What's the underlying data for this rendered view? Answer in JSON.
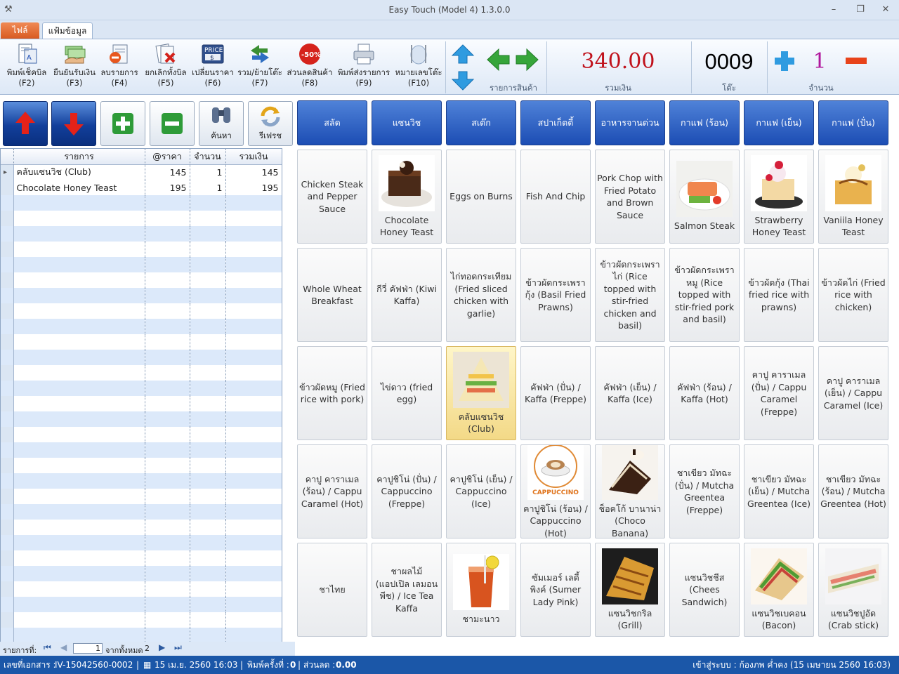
{
  "window": {
    "title": "Easy Touch (Model 4) 1.3.0.0"
  },
  "tabs": {
    "file": "ไฟล์",
    "data": "แฟ้มข้อมูล"
  },
  "ribbon": {
    "buttons": [
      {
        "label": "พิมพ์เช็คบิล",
        "key": "(F2)",
        "icon": "bill-icon"
      },
      {
        "label": "ยืนยันรับเงิน",
        "key": "(F3)",
        "icon": "cash-icon"
      },
      {
        "label": "ลบรายการ",
        "key": "(F4)",
        "icon": "delete-item-icon"
      },
      {
        "label": "ยกเลิกทั้งบิล",
        "key": "(F5)",
        "icon": "cancel-bill-icon"
      },
      {
        "label": "เปลี่ยนราคา",
        "key": "(F6)",
        "icon": "price-tag-icon"
      },
      {
        "label": "รวม/ย้ายโต๊ะ",
        "key": "(F7)",
        "icon": "move-table-icon"
      },
      {
        "label": "ส่วนลดสินค้า",
        "key": "(F8)",
        "icon": "discount-icon"
      },
      {
        "label": "พิมพ์ส่งรายการ",
        "key": "(F9)",
        "icon": "printer-icon"
      },
      {
        "label": "หมายเลขโต๊ะ",
        "key": "(F10)",
        "icon": "table-number-icon"
      }
    ],
    "price_badge": "PRICE",
    "discount_badge": "-50%",
    "group_items_label": "รายการสินค้า",
    "total_value": "340.00",
    "total_label": "รวมเงิน",
    "table_value": "0009",
    "table_label": "โต๊ะ",
    "qty_value": "1",
    "qty_label": "จำนวน"
  },
  "toolbar": {
    "search_label": "ค้นหา",
    "refresh_label": "รีเฟรช"
  },
  "grid": {
    "headers": [
      "รายการ",
      "@ราคา",
      "จำนวน",
      "รวมเงิน"
    ],
    "rows": [
      {
        "item": "คลับแซนวิช (Club)",
        "price": "145",
        "qty": "1",
        "total": "145"
      },
      {
        "item": "Chocolate Honey Teast",
        "price": "195",
        "qty": "1",
        "total": "195"
      }
    ]
  },
  "nav": {
    "label": "รายการที่:",
    "page": "1",
    "of_label": "จากทั้งหมด",
    "total": "2"
  },
  "categories": [
    "สลัด",
    "แซนวิช",
    "สเต๊ก",
    "สปาเก็ตตี้",
    "อาหารจานด่วน",
    "กาแฟ (ร้อน)",
    "กาแฟ (เย็น)",
    "กาแฟ (ปั่น)"
  ],
  "products": [
    {
      "name": "Chicken Steak and Pepper Sauce"
    },
    {
      "name": "Chocolate Honey Teast",
      "img": "chocolate-toast"
    },
    {
      "name": "Eggs on Burns"
    },
    {
      "name": "Fish And Chip"
    },
    {
      "name": "Pork Chop with Fried Potato and Brown Sauce"
    },
    {
      "name": "Salmon Steak",
      "img": "salmon"
    },
    {
      "name": "Strawberry Honey Teast",
      "img": "strawberry-toast"
    },
    {
      "name": "Vaniila Honey Teast",
      "img": "vanilla-toast"
    },
    {
      "name": "Whole Wheat Breakfast"
    },
    {
      "name": "กีวี่ คัฟฟ่า (Kiwi Kaffa)"
    },
    {
      "name": "ไก่ทอดกระเทียม (Fried sliced chicken with garlie)"
    },
    {
      "name": "ข้าวผัดกระเพรากุ้ง (Basil Fried Prawns)"
    },
    {
      "name": "ข้าวผัดกระเพราไก่ (Rice topped with stir-fried chicken and basil)"
    },
    {
      "name": "ข้าวผัดกระเพราหมู (Rice topped with stir-fried pork and basil)"
    },
    {
      "name": "ข้าวผัดกุ้ง (Thai fried rice with prawns)"
    },
    {
      "name": "ข้าวผัดไก่ (Fried rice with chicken)"
    },
    {
      "name": "ข้าวผัดหมู (Fried rice with pork)"
    },
    {
      "name": "ไข่ดาว (fried egg)"
    },
    {
      "name": "คลับแซนวิช (Club)",
      "img": "club-sandwich",
      "selected": true
    },
    {
      "name": "คัฟฟ่า (ปั่น) / Kaffa (Freppe)"
    },
    {
      "name": "คัฟฟ่า (เย็น) / Kaffa (Ice)"
    },
    {
      "name": "คัฟฟ่า (ร้อน) / Kaffa (Hot)"
    },
    {
      "name": "คาปู คาราเมล (ปั่น) / Cappu Caramel (Freppe)"
    },
    {
      "name": "คาปู คาราเมล (เย็น) / Cappu Caramel (Ice)"
    },
    {
      "name": "คาปู คาราเมล (ร้อน) / Cappu Caramel (Hot)"
    },
    {
      "name": "คาปูชิโน่ (ปั่น) / Cappuccino (Freppe)"
    },
    {
      "name": "คาปูชิโน่ (เย็น) / Cappuccino (Ice)"
    },
    {
      "name": "คาปูชิโน่ (ร้อน) / Cappuccino (Hot)",
      "img": "cappuccino",
      "img_text": "CAPPUCCINO"
    },
    {
      "name": "ช็อคโก้ บานาน่า (Choco Banana)",
      "img": "choco-banana"
    },
    {
      "name": "ชาเขียว มัทฉะ (ปั่น) / Mutcha Greentea (Freppe)"
    },
    {
      "name": "ชาเขียว มัทฉะ (เย็น) / Mutcha Greentea (Ice)"
    },
    {
      "name": "ชาเขียว มัทฉะ (ร้อน) / Mutcha Greentea (Hot)"
    },
    {
      "name": "ชาไทย"
    },
    {
      "name": "ชาผลไม้ (แอปเปิล เลมอน พีช) / Ice Tea Kaffa"
    },
    {
      "name": "ชามะนาว",
      "img": "lemon-tea"
    },
    {
      "name": "ซัมเมอร์ เลดี้ พิงค์ (Sumer Lady Pink)"
    },
    {
      "name": "แซนวิชกริล (Grill)",
      "img": "grill-sandwich"
    },
    {
      "name": "แซนวิชชีส (Chees Sandwich)"
    },
    {
      "name": "แซนวิชเบคอน (Bacon)",
      "img": "bacon-sandwich"
    },
    {
      "name": "แซนวิชปูอัด (Crab stick)",
      "img": "crab-sandwich"
    }
  ],
  "status": {
    "doc_label": "เลขที่เอกสาร :",
    "doc_no": "IV-15042560-0002",
    "date": "15 เม.ย. 2560 16:03",
    "print_label": "พิมพ์ครั้งที่ :",
    "print_count": "0",
    "discount_label": "ส่วนลด :",
    "discount": "0.00",
    "login": "เข้าสู่ระบบ : ก้องภพ ค่ำคง (15 เมษายน 2560 16:03)"
  },
  "colors": {
    "accent": "#1c4db4",
    "total_red": "#c0121c",
    "qty_purple": "#b0169c",
    "status_bar": "#1b57a8"
  }
}
